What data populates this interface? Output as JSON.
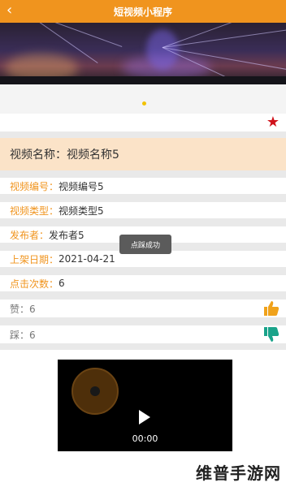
{
  "header": {
    "title": "短视频小程序",
    "back_icon": "chevron-left-icon"
  },
  "banner": {
    "description_icon": "night-city-light-show-image"
  },
  "favorite": {
    "icon": "star-icon",
    "color": "#d0121b"
  },
  "video_name": {
    "label": "视频名称：",
    "value": "视频名称5"
  },
  "fields": [
    {
      "label": "视频编号：",
      "value": "视频编号5"
    },
    {
      "label": "视频类型：",
      "value": "视频类型5"
    },
    {
      "label": "发布者：",
      "value": "发布者5"
    },
    {
      "label": "上架日期：",
      "value": "2021-04-21"
    },
    {
      "label": "点击次数：",
      "value": "6"
    }
  ],
  "likes": {
    "label": "赞：",
    "value": "6",
    "icon": "thumbs-up-icon",
    "color": "#f0a21b"
  },
  "dislikes": {
    "label": "踩：",
    "value": "6",
    "icon": "thumbs-down-icon",
    "color": "#1aa38a"
  },
  "toast": {
    "text": "点踩成功"
  },
  "video": {
    "time": "00:00",
    "play_icon": "play-icon"
  },
  "watermark": {
    "text": "维普手游网"
  },
  "accent_color": "#f0941e"
}
